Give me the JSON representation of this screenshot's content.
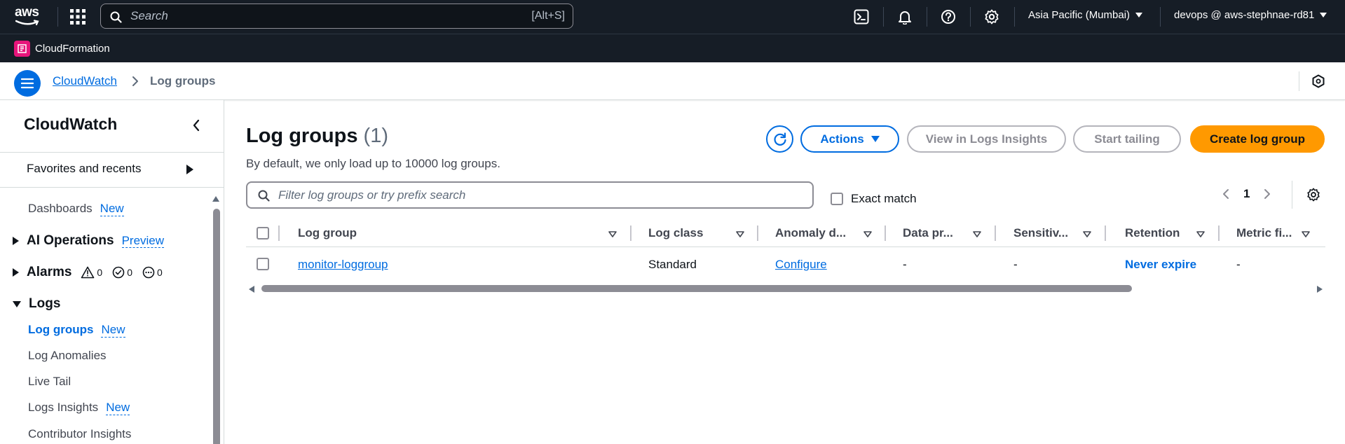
{
  "topnav": {
    "logo_text": "aws",
    "search_placeholder": "Search",
    "search_shortcut": "[Alt+S]",
    "region": "Asia Pacific (Mumbai)",
    "account": "devops @ aws-stephnae-rd81"
  },
  "servicebar": {
    "favorite": "CloudFormation",
    "favorite_color": "#e7157b"
  },
  "breadcrumb": {
    "parent": "CloudWatch",
    "current": "Log groups"
  },
  "sidebar": {
    "title": "CloudWatch",
    "favorites": "Favorites and recents",
    "items": [
      {
        "label": "Dashboards",
        "tag": "New"
      },
      {
        "label": "AI Operations",
        "tag": "Preview"
      },
      {
        "label": "Alarms",
        "counts": [
          "0",
          "0",
          "0"
        ]
      },
      {
        "label": "Logs"
      },
      {
        "label": "Log groups",
        "tag": "New"
      },
      {
        "label": "Log Anomalies"
      },
      {
        "label": "Live Tail"
      },
      {
        "label": "Logs Insights",
        "tag": "New"
      },
      {
        "label": "Contributor Insights"
      }
    ]
  },
  "main": {
    "title": "Log groups",
    "count": "(1)",
    "description": "By default, we only load up to 10000 log groups.",
    "buttons": {
      "actions": "Actions",
      "view_insights": "View in Logs Insights",
      "start_tailing": "Start tailing",
      "create": "Create log group"
    },
    "filter_placeholder": "Filter log groups or try prefix search",
    "exact_match": "Exact match",
    "page": "1",
    "columns": [
      "Log group",
      "Log class",
      "Anomaly d...",
      "Data pr...",
      "Sensitiv...",
      "Retention",
      "Metric fi..."
    ],
    "rows": [
      {
        "log_group": "monitor-loggroup",
        "log_class": "Standard",
        "anomaly": "Configure",
        "data_protection": "-",
        "sensitive": "-",
        "retention": "Never expire",
        "metric_filters": "-"
      }
    ]
  },
  "colors": {
    "nav_bg": "#161d26",
    "link": "#006ce0",
    "primary_button": "#ff9900"
  }
}
